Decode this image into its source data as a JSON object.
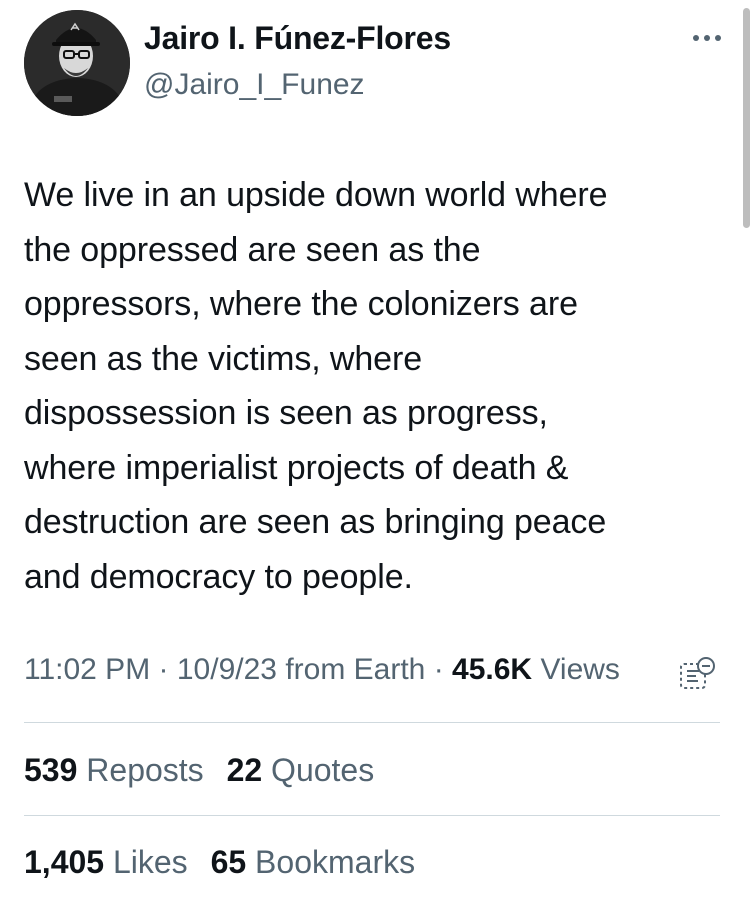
{
  "author": {
    "name": "Jairo I. Fúnez-Flores",
    "handle": "@Jairo_I_Funez",
    "avatar": "profile-photo"
  },
  "tweet": {
    "text": "We live in an upside down world where\nthe oppressed are seen as the\noppressors, where the colonizers are\nseen as the victims, where\ndispossession is seen as progress,\nwhere imperialist projects of death &\ndestruction are seen as bringing peace\nand democracy to people."
  },
  "meta": {
    "time": "11:02 PM",
    "separator": "·",
    "date": "10/9/23",
    "source": "from Earth",
    "views_count": "45.6K",
    "views_label": "Views"
  },
  "stats": {
    "reposts_count": "539",
    "reposts_label": "Reposts",
    "quotes_count": "22",
    "quotes_label": "Quotes",
    "likes_count": "1,405",
    "likes_label": "Likes",
    "bookmarks_count": "65",
    "bookmarks_label": "Bookmarks"
  },
  "icons": {
    "more": "more-options-icon",
    "analytics": "post-analytics-icon"
  },
  "colors": {
    "text": "#0f1419",
    "secondary": "#536471",
    "divider": "#cfd9de",
    "background": "#ffffff"
  }
}
